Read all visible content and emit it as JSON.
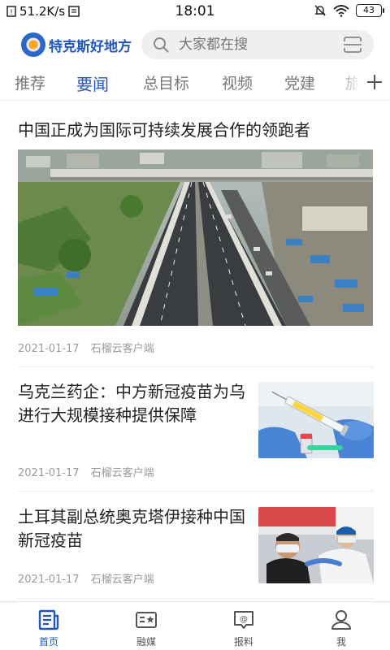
{
  "status_bar": {
    "network_speed": "51.2K/s",
    "time": "18:01",
    "battery": "43"
  },
  "header": {
    "app_name": "特克斯好地方",
    "search_placeholder": "大家都在搜"
  },
  "tabs": [
    {
      "label": "推荐",
      "active": false
    },
    {
      "label": "要闻",
      "active": true
    },
    {
      "label": "总目标",
      "active": false
    },
    {
      "label": "视频",
      "active": false
    },
    {
      "label": "党建",
      "active": false
    },
    {
      "label": "旅",
      "active": false
    }
  ],
  "feed": {
    "articles": [
      {
        "title": "中国正成为国际可持续发展合作的领跑者",
        "date": "2021-01-17",
        "source": "石榴云客户端"
      },
      {
        "title": "乌克兰药企：中方新冠疫苗为乌进行大规模接种提供保障",
        "date": "2021-01-17",
        "source": "石榴云客户端"
      },
      {
        "title": "土耳其副总统奥克塔伊接种中国新冠疫苗",
        "date": "2021-01-17",
        "source": "石榴云客户端"
      }
    ]
  },
  "bottom_nav": [
    {
      "label": "首页",
      "icon": "home-news-icon",
      "active": true
    },
    {
      "label": "融媒",
      "icon": "media-card-icon",
      "active": false
    },
    {
      "label": "报料",
      "icon": "report-bubble-icon",
      "active": false
    },
    {
      "label": "我",
      "icon": "user-icon",
      "active": false
    }
  ],
  "colors": {
    "accent": "#1f58b8",
    "inactive_text": "#777777",
    "meta_text": "#9a9a9a"
  }
}
